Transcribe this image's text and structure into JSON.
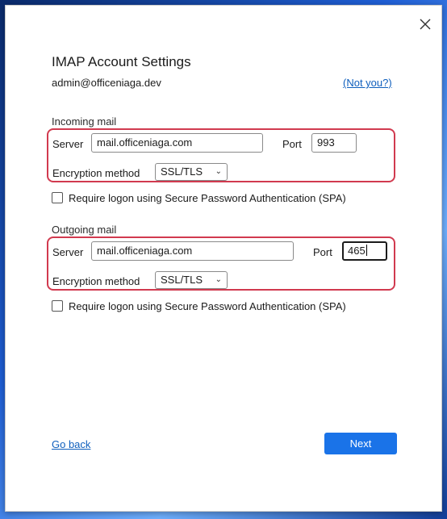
{
  "dialog": {
    "title": "IMAP Account Settings",
    "email": "admin@officeniaga.dev",
    "not_you": "(Not you?)",
    "close_icon": "close-icon"
  },
  "incoming": {
    "heading": "Incoming mail",
    "server_label": "Server",
    "server_value": "mail.officeniaga.com",
    "port_label": "Port",
    "port_value": "993",
    "encryption_label": "Encryption method",
    "encryption_value": "SSL/TLS",
    "spa_label": "Require logon using Secure Password Authentication (SPA)",
    "spa_checked": false
  },
  "outgoing": {
    "heading": "Outgoing mail",
    "server_label": "Server",
    "server_value": "mail.officeniaga.com",
    "port_label": "Port",
    "port_value": "465",
    "encryption_label": "Encryption method",
    "encryption_value": "SSL/TLS",
    "spa_label": "Require logon using Secure Password Authentication (SPA)",
    "spa_checked": false
  },
  "footer": {
    "go_back": "Go back",
    "next": "Next"
  },
  "colors": {
    "accent": "#1a73e8",
    "highlight_border": "#d13a4f",
    "link": "#0f5fbd"
  }
}
